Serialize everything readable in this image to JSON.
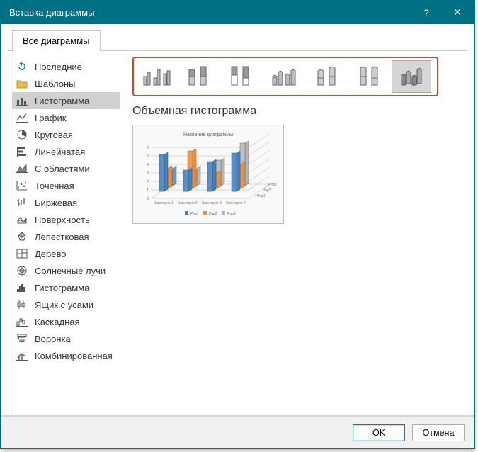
{
  "window": {
    "title": "Вставка диаграммы",
    "help_label": "?",
    "close_label": "✕"
  },
  "tabs": {
    "all": "Все диаграммы"
  },
  "sidebar": {
    "items": [
      {
        "id": "recent",
        "label": "Последние",
        "icon": "undo"
      },
      {
        "id": "templates",
        "label": "Шаблоны",
        "icon": "folder"
      },
      {
        "id": "column",
        "label": "Гистограмма",
        "icon": "column"
      },
      {
        "id": "line",
        "label": "График",
        "icon": "line"
      },
      {
        "id": "pie",
        "label": "Круговая",
        "icon": "pie"
      },
      {
        "id": "bar",
        "label": "Линейчатая",
        "icon": "bar"
      },
      {
        "id": "area",
        "label": "С областями",
        "icon": "area"
      },
      {
        "id": "scatter",
        "label": "Точечная",
        "icon": "scatter"
      },
      {
        "id": "stock",
        "label": "Биржевая",
        "icon": "stock"
      },
      {
        "id": "surface",
        "label": "Поверхность",
        "icon": "surface"
      },
      {
        "id": "radar",
        "label": "Лепестковая",
        "icon": "radar"
      },
      {
        "id": "treemap",
        "label": "Дерево",
        "icon": "treemap"
      },
      {
        "id": "sunburst",
        "label": "Солнечные лучи",
        "icon": "sunburst"
      },
      {
        "id": "histogram",
        "label": "Гистограмма",
        "icon": "histogram"
      },
      {
        "id": "boxwhisker",
        "label": "Ящик с усами",
        "icon": "box"
      },
      {
        "id": "waterfall",
        "label": "Каскадная",
        "icon": "waterfall"
      },
      {
        "id": "funnel",
        "label": "Воронка",
        "icon": "funnel"
      },
      {
        "id": "combo",
        "label": "Комбинированная",
        "icon": "combo"
      }
    ],
    "selected": "column"
  },
  "subtype": {
    "title": "Объемная гистограмма",
    "variants": [
      "clustered-column",
      "stacked-column",
      "100-stacked-column",
      "3d-clustered-column",
      "3d-stacked-column",
      "3d-100-stacked-column",
      "3d-column"
    ],
    "selected_variant": "3d-column"
  },
  "preview": {
    "chart_title": "Название диаграммы",
    "legend": [
      "Ряд1",
      "Ряд2",
      "Ряд3"
    ],
    "depth_labels": [
      "Ряд1",
      "Ряд2",
      "Ряд3"
    ],
    "categories": [
      "Категория 1",
      "Категория 2",
      "Категория 3",
      "Категория 4"
    ],
    "ylim": [
      0,
      6
    ]
  },
  "footer": {
    "ok": "OK",
    "cancel": "Отмена"
  },
  "chart_data": {
    "type": "bar",
    "title": "Название диаграммы",
    "categories": [
      "Категория 1",
      "Категория 2",
      "Категория 3",
      "Категория 4"
    ],
    "series": [
      {
        "name": "Ряд1",
        "values": [
          4.3,
          2.5,
          3.5,
          4.5
        ]
      },
      {
        "name": "Ряд2",
        "values": [
          2.4,
          4.4,
          1.8,
          2.8
        ]
      },
      {
        "name": "Ряд3",
        "values": [
          2.0,
          2.0,
          3.0,
          5.0
        ]
      }
    ],
    "xlabel": "",
    "ylabel": "",
    "ylim": [
      0,
      6
    ]
  }
}
